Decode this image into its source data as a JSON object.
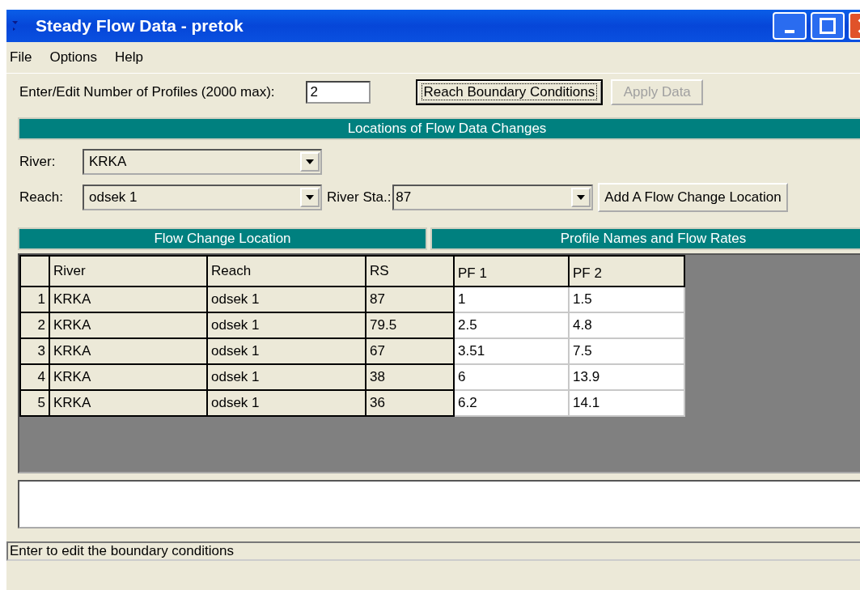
{
  "window": {
    "title": "Steady Flow Data - pretok"
  },
  "menu": [
    "File",
    "Options",
    "Help"
  ],
  "profiles": {
    "label": "Enter/Edit Number of Profiles (2000 max):",
    "value": "2"
  },
  "buttons": [
    {
      "label": "Reach Boundary Conditions",
      "disabled": false,
      "focused": true
    },
    {
      "label": "Apply Data",
      "disabled": true,
      "focused": false
    }
  ],
  "locations": {
    "title": "Locations of Flow Data Changes",
    "river": {
      "label": "River:",
      "value": "KRKA"
    },
    "reach": {
      "label": "Reach:",
      "value": "odsek 1"
    },
    "station": {
      "label": "River Sta.:",
      "value": "87"
    },
    "add_button": "Add A Flow Change Location"
  },
  "table": {
    "groups": [
      "Flow Change Location",
      "Profile Names and Flow Rates"
    ],
    "columns": [
      {
        "label": "River",
        "kind": "fixed"
      },
      {
        "label": "Reach",
        "kind": "fixed"
      },
      {
        "label": "RS",
        "kind": "fixed"
      },
      {
        "label": "PF 1",
        "kind": "flow"
      },
      {
        "label": "PF 2",
        "kind": "flow"
      }
    ],
    "rows": [
      {
        "index": "1",
        "cells": [
          "KRKA",
          "odsek 1",
          "87",
          "1",
          "1.5"
        ]
      },
      {
        "index": "2",
        "cells": [
          "KRKA",
          "odsek 1",
          "79.5",
          "2.5",
          "4.8"
        ]
      },
      {
        "index": "3",
        "cells": [
          "KRKA",
          "odsek 1",
          "67",
          "3.51",
          "7.5"
        ]
      },
      {
        "index": "4",
        "cells": [
          "KRKA",
          "odsek 1",
          "38",
          "6",
          "13.9"
        ]
      },
      {
        "index": "5",
        "cells": [
          "KRKA",
          "odsek 1",
          "36",
          "6.2",
          "14.1"
        ]
      }
    ]
  },
  "status_bar": "Enter to edit the boundary conditions"
}
